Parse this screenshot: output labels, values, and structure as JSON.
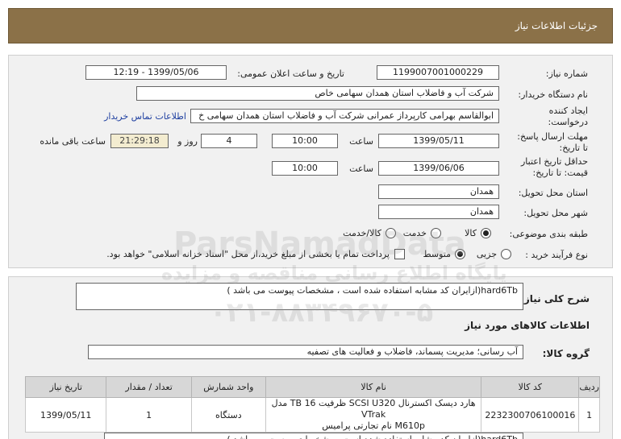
{
  "header": {
    "title": "جزئیات اطلاعات نیاز"
  },
  "form": {
    "need_number": {
      "label": "شماره نیاز:",
      "value": "1199007001000229"
    },
    "announce": {
      "label": "تاریخ و ساعت اعلان عمومی:",
      "value": "1399/05/06 - 12:19"
    },
    "buyer": {
      "label": "نام دستگاه خریدار:",
      "value": "شرکت آب و فاضلاب استان همدان سهامی خاص"
    },
    "creator": {
      "label_line1": "ایجاد کننده",
      "label_line2": "درخواست:",
      "value": "ابوالقاسم بهرامی کارپرداز عمرانی شرکت آب و فاضلاب استان همدان سهامی خ",
      "contact_link": "اطلاعات تماس خریدار"
    },
    "deadline": {
      "label_line1": "مهلت ارسال پاسخ:",
      "label_line2": "تا تاریخ:",
      "date": "1399/05/11",
      "time_label": "ساعت",
      "time": "10:00",
      "days": "4",
      "days_label": "روز و",
      "remaining": "21:29:18",
      "remaining_label": "ساعت باقی مانده"
    },
    "validity": {
      "label_line1": "حداقل تاریخ اعتبار",
      "label_line2": "قیمت: تا تاریخ:",
      "date": "1399/06/06",
      "time_label": "ساعت",
      "time": "10:00"
    },
    "province": {
      "label": "استان محل تحویل:",
      "value": "همدان"
    },
    "city": {
      "label": "شهر محل تحویل:",
      "value": "همدان"
    },
    "category": {
      "label": "طبقه بندی موضوعی:",
      "options": [
        "کالا",
        "خدمت",
        "کالا/خدمت"
      ],
      "selected": 0
    },
    "process": {
      "label": "نوع فرآیند خرید :",
      "options": [
        "جزیی",
        "متوسط"
      ],
      "selected": 1,
      "checkbox_text": "پرداخت تمام یا بخشی از مبلغ خرید،از محل \"اسناد خزانه اسلامی\" خواهد بود."
    }
  },
  "summary": {
    "label": "شرح کلی نیاز:",
    "value": "hard6Tb(ازایران کد مشابه استفاده شده است ، مشخصات پیوست می باشد )"
  },
  "goods": {
    "section_title": "اطلاعات کالاهای مورد نیاز",
    "group_label": "گروه کالا:",
    "group_value": "آب رسانی؛ مدیریت پسماند، فاضلاب و فعالیت های تصفیه",
    "columns": [
      "ردیف",
      "کد کالا",
      "نام کالا",
      "واحد شمارش",
      "تعداد / مقدار",
      "تاریخ نیاز"
    ],
    "rows": [
      {
        "index": "1",
        "code": "2232300706100016",
        "name_line1": "هارد دیسک اکسترنال SCSI U320 ظرفیت 16 TB مدل VTrak",
        "name_line2": "M610p نام تجارتی پرامیس",
        "unit": "دستگاه",
        "qty": "1",
        "date": "1399/05/11"
      }
    ],
    "footer_text": "hard6Tb(ازایران کد مشابه استفاده شده است ، مشخصات پیوست می باشد )"
  },
  "watermark": {
    "brand": "ParsNamadData",
    "line1": "پایگاه اطلاع رسانی مناقصه و مزایده",
    "phone": "۰۲۱-۸۸۳۴۹۶۷۰-۵"
  }
}
